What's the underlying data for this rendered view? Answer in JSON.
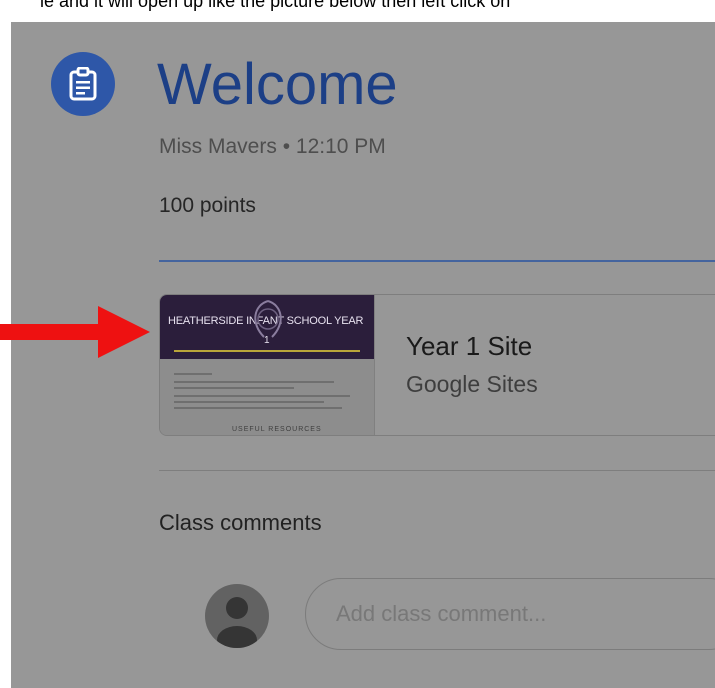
{
  "instruction": {
    "text": "le and it will open up like the picture below then left click on"
  },
  "assignment": {
    "icon": "assignment-icon",
    "title": "Welcome",
    "author": "Miss Mavers",
    "separator": "•",
    "time": "12:10 PM",
    "points": "100 points"
  },
  "attachment": {
    "title": "Year 1 Site",
    "subtitle": "Google Sites",
    "thumbnail_title": "HEATHERSIDE INFANT SCHOOL YEAR",
    "thumbnail_number": "1",
    "thumbnail_footer": "USEFUL RESOURCES"
  },
  "comments": {
    "heading": "Class comments",
    "placeholder": "Add class comment..."
  },
  "colors": {
    "overlay": "#979797",
    "icon_bg": "#2e57a8",
    "title": "#1c3f86",
    "arrow": "#ee1111"
  }
}
